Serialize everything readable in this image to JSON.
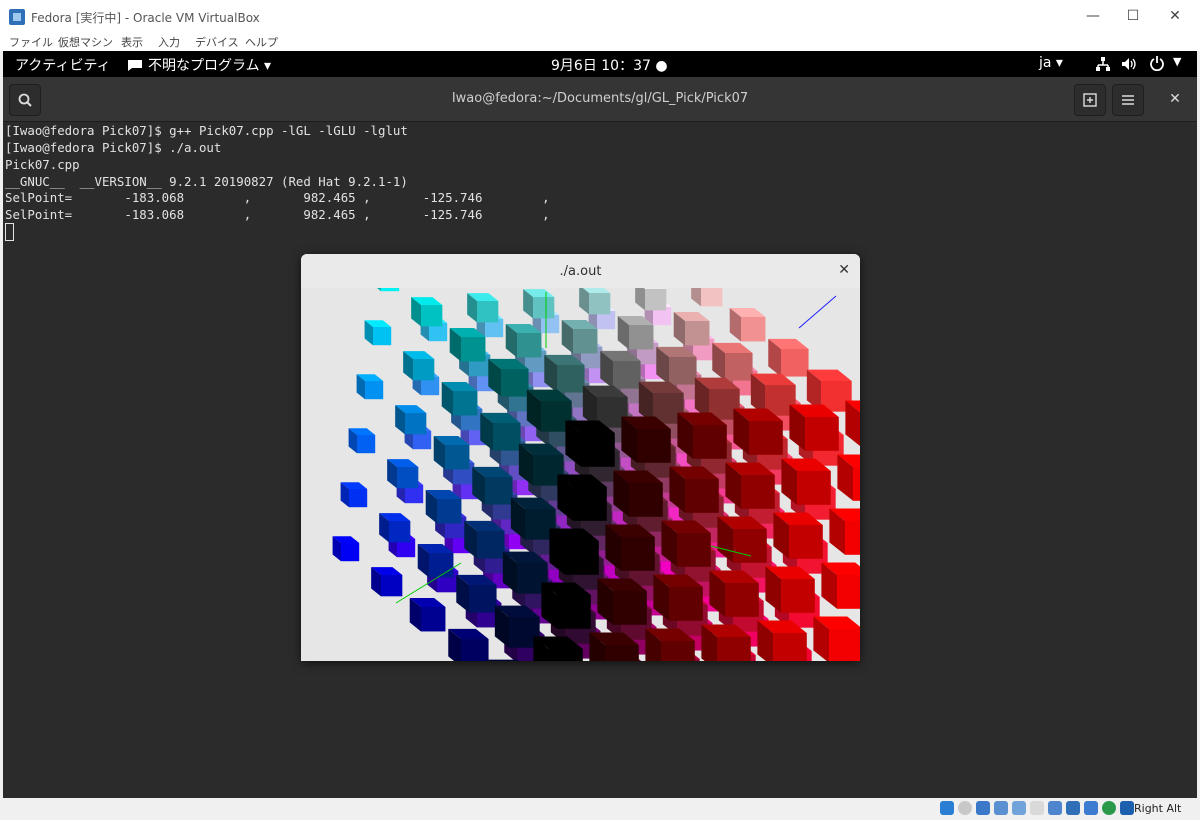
{
  "vbox": {
    "title": "Fedora [実行中] - Oracle VM VirtualBox",
    "menu": [
      "ファイル",
      "仮想マシン",
      "表示",
      "入力",
      "デバイス",
      "ヘルプ"
    ],
    "host_key": "Right Alt"
  },
  "topbar": {
    "activities": "アクティビティ",
    "app_menu": "不明なプログラム ▾",
    "clock": "9月6日  10：37 ●",
    "lang": "ja ▾"
  },
  "terminal": {
    "title": "Iwao@fedora:~/Documents/gl/GL_Pick/Pick07",
    "lines": [
      "[Iwao@fedora Pick07]$ g++ Pick07.cpp -lGL -lGLU -lglut",
      "[Iwao@fedora Pick07]$ ./a.out",
      "Pick07.cpp",
      "__GNUC__  __VERSION__ 9.2.1 20190827 (Red Hat 9.2.1-1)",
      "SelPoint=       -183.068        ,       982.465 ,       -125.746        ,",
      "SelPoint=       -183.068        ,       982.465 ,       -125.746        ,"
    ]
  },
  "glwindow": {
    "title": "./a.out",
    "background": "#e6e6e6",
    "axes": {
      "x": "#00cc00",
      "y": "#00cc00",
      "z": "#2020ff"
    }
  }
}
